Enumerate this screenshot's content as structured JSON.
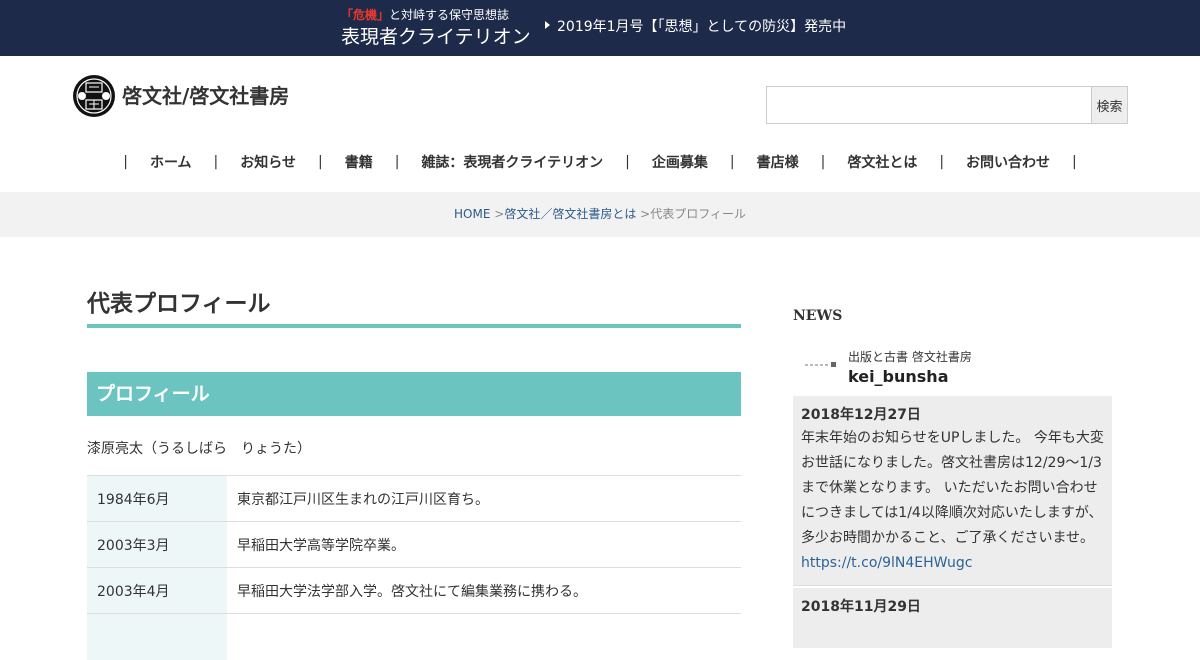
{
  "topbar": {
    "crisis": "「危機」",
    "tagline_rest": "と対峙する保守思想誌",
    "magazine": "表現者クライテリオン",
    "promo": "2019年1月号【「思想」としての防災】発売中"
  },
  "header": {
    "site_name": "啓文社/啓文社書房",
    "search_placeholder": "",
    "search_button": "検索"
  },
  "nav": {
    "items": [
      "ホーム",
      "お知らせ",
      "書籍",
      "雑誌：表現者クライテリオン",
      "企画募集",
      "書店様",
      "啓文社とは",
      "お問い合わせ"
    ],
    "separator": "|"
  },
  "breadcrumb": {
    "home": "HOME",
    "sep1": " >",
    "parent": "啓文社／啓文社書房とは",
    "sep2": " >",
    "current": "代表プロフィール"
  },
  "main": {
    "title": "代表プロフィール",
    "section": "プロフィール",
    "name": "漆原亮太（うるしばら　りょうた）",
    "rows": [
      {
        "date": "1984年6月",
        "desc": "東京都江戸川区生まれの江戸川区育ち。"
      },
      {
        "date": "2003年3月",
        "desc": "早稲田大学高等学院卒業。"
      },
      {
        "date": "2003年4月",
        "desc": "早稲田大学法学部入学。啓文社にて編集業務に携わる。"
      },
      {
        "date": "",
        "desc": ""
      }
    ]
  },
  "sidebar": {
    "news_heading": "NEWS",
    "account_sub": "出版と古書 啓文社書房",
    "account_handle": "kei_bunsha",
    "tweets": [
      {
        "date": "2018年12月27日",
        "text": "年末年始のお知らせをUPしました。 今年も大変お世話になりました。啓文社書房は12/29～1/3まで休業となります。 いただいたお問い合わせにつきましては1/4以降順次対応いたしますが、多少お時間かかること、ご了承くださいませ。 ",
        "link": "https://t.co/9lN4EHWugc"
      },
      {
        "date": "2018年11月29日",
        "text": "",
        "link": ""
      }
    ]
  },
  "colors": {
    "topbar_bg": "#1e2a4a",
    "accent": "#6cc4c0",
    "crisis_red": "#e8392b",
    "link": "#2a5a8c"
  }
}
